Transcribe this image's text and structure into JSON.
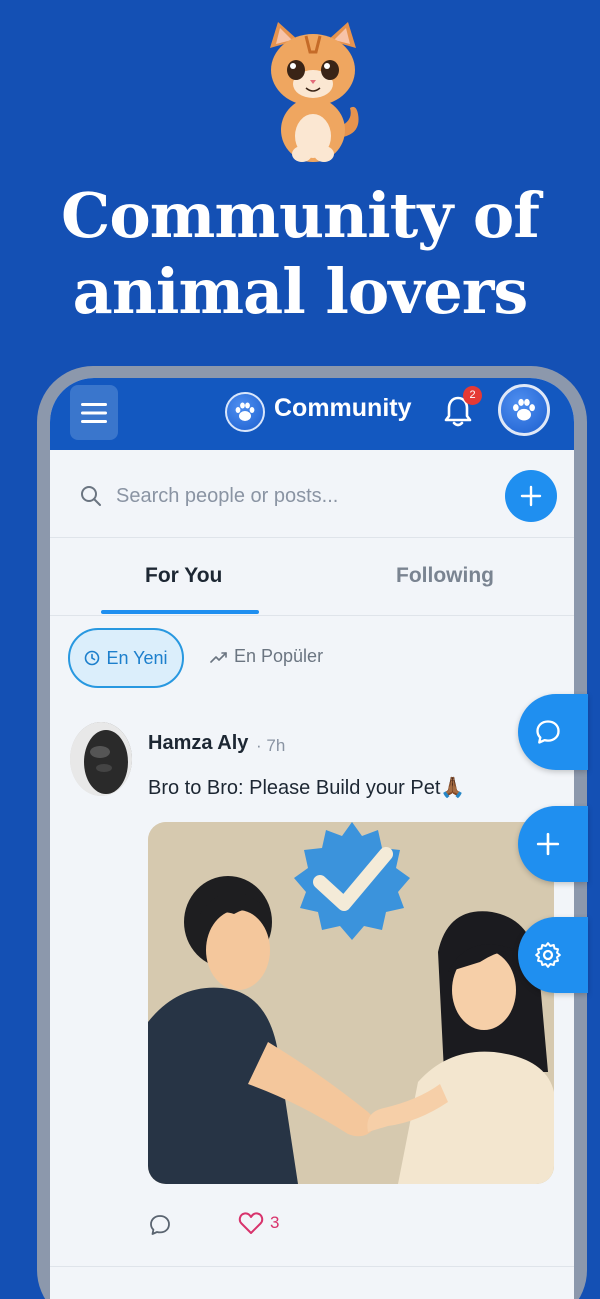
{
  "hero": {
    "headline_line1": "Community of",
    "headline_line2": "animal lovers",
    "mascot_icon": "kitten-mascot"
  },
  "appbar": {
    "title": "Community",
    "notification_count": "2",
    "menu_icon": "hamburger-icon",
    "logo_icon": "paw-icon",
    "profile_icon": "paw-icon"
  },
  "search": {
    "placeholder": "Search people or posts..."
  },
  "tabs": [
    {
      "label": "For You",
      "active": true
    },
    {
      "label": "Following",
      "active": false
    }
  ],
  "filters": [
    {
      "label": "En Yeni",
      "icon": "clock-icon",
      "active": true
    },
    {
      "label": "En Popüler",
      "icon": "trending-icon",
      "active": false
    }
  ],
  "post": {
    "author": "Hamza Aly",
    "time": "· 7h",
    "text": "Bro to Bro: Please Build your Pet🙏🏾",
    "likes": "3"
  },
  "colors": {
    "background": "#1450b4",
    "appbar": "#1358c0",
    "accent": "#1f8ff0",
    "like": "#d8336c",
    "badge": "#e53935"
  }
}
